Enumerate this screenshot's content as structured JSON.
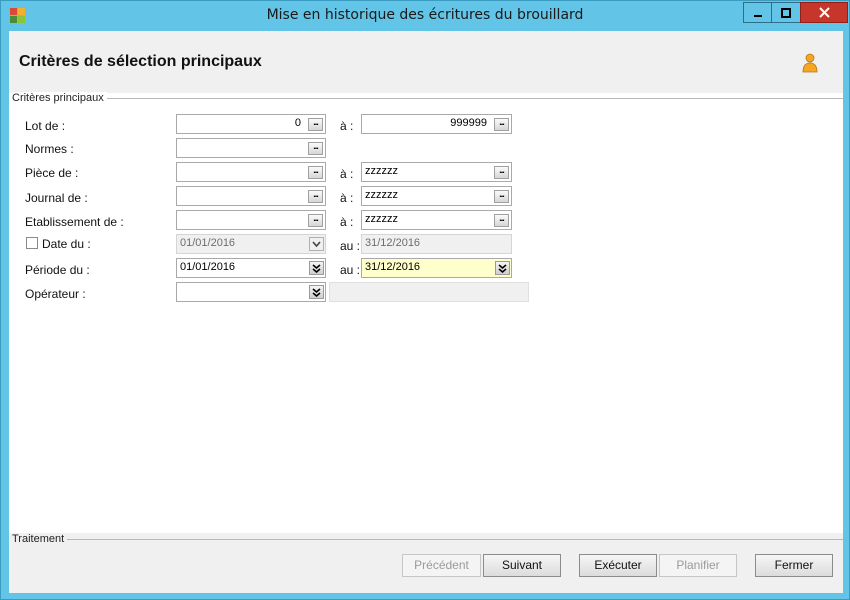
{
  "window": {
    "title": "Mise en historique des écritures du brouillard"
  },
  "header": {
    "title": "Critères de sélection principaux"
  },
  "criteria": {
    "group_label": "Critères principaux",
    "lot": {
      "label": "Lot de :",
      "from": "0",
      "to_label": "à :",
      "to": "999999"
    },
    "normes": {
      "label": "Normes :",
      "value": ""
    },
    "piece": {
      "label": "Pièce de :",
      "from": "",
      "to_label": "à :",
      "to": "zzzzzz"
    },
    "journal": {
      "label": "Journal de :",
      "from": "",
      "to_label": "à :",
      "to": "zzzzzz"
    },
    "etablissement": {
      "label": "Etablissement de :",
      "from": "",
      "to_label": "à :",
      "to": "zzzzzz"
    },
    "date": {
      "label": "Date du :",
      "checked": false,
      "from": "01/01/2016",
      "to_label": "au :",
      "to": "31/12/2016"
    },
    "periode": {
      "label": "Période du :",
      "from": "01/01/2016",
      "to_label": "au :",
      "to": "31/12/2016"
    },
    "operateur": {
      "label": "Opérateur :",
      "value": "",
      "description": ""
    }
  },
  "footer": {
    "group_label": "Traitement",
    "buttons": {
      "precedent": "Précédent",
      "suivant": "Suivant",
      "executer": "Exécuter",
      "planifier": "Planifier",
      "fermer": "Fermer"
    }
  },
  "ellipsis_glyph": "...",
  "icons": {
    "app": "app-icon",
    "user": "user-icon",
    "minimize": "minimize-icon",
    "maximize": "maximize-icon",
    "close": "close-icon",
    "ellipsis": "ellipsis-icon",
    "chevron": "double-chevron-down-icon"
  },
  "colors": {
    "titlebar": "#62c4e6",
    "close_button": "#c7362b",
    "highlight_field": "#ffffcc",
    "user_icon": "#f5a623"
  }
}
